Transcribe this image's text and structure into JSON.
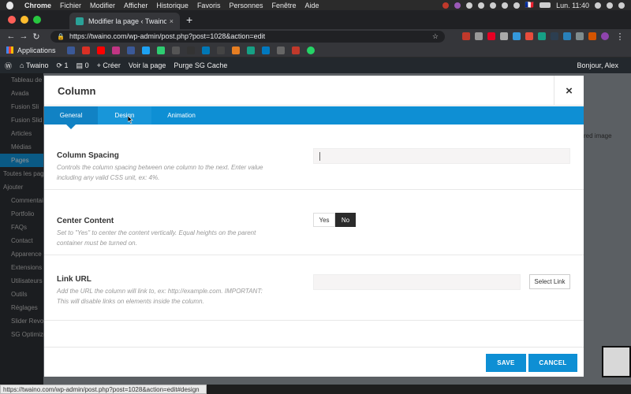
{
  "macos_menubar": {
    "app": "Chrome",
    "menus": [
      "Fichier",
      "Modifier",
      "Afficher",
      "Historique",
      "Favoris",
      "Personnes",
      "Fenêtre",
      "Aide"
    ],
    "flag": "🇫🇷",
    "clock": "Lun. 11:40"
  },
  "browser": {
    "tab_title": "Modifier la page ‹ Twaino — W",
    "url": "https://twaino.com/wp-admin/post.php?post=1028&action=edit",
    "new_tab": "+",
    "bookmarks_apps": "Applications",
    "status_url": "https://twaino.com/wp-admin/post.php?post=1028&action=edit#design"
  },
  "wp_admin_bar": {
    "site": "Twaino",
    "updates": "1",
    "comments": "0",
    "create": "Créer",
    "view_page": "Voir la page",
    "purge": "Purge SG Cache",
    "greeting": "Bonjour, Alex"
  },
  "wp_sidebar": {
    "items": [
      "Tableau de",
      "Avada",
      "Fusion Sli",
      "Fusion Slid",
      "Articles",
      "Médias",
      "Pages",
      "Toutes les pag",
      "Ajouter",
      "Commentai",
      "Portfolio",
      "FAQs",
      "Contact",
      "Apparence",
      "Extensions",
      "Utilisateurs",
      "Outils",
      "Réglages",
      "Slider Revol",
      "SG Optimizer"
    ]
  },
  "background": {
    "right_text": "red image"
  },
  "modal": {
    "title": "Column",
    "close": "×",
    "tabs": [
      "General",
      "Design",
      "Animation"
    ],
    "active_tab": "General",
    "options": {
      "column_spacing": {
        "label": "Column Spacing",
        "description": "Controls the column spacing between one column to the next. Enter value including any valid CSS unit, ex: 4%.",
        "value": ""
      },
      "center_content": {
        "label": "Center Content",
        "description": "Set to \"Yes\" to center the content vertically. Equal heights on the parent container must be turned on.",
        "yes": "Yes",
        "no": "No",
        "selected": "No"
      },
      "link_url": {
        "label": "Link URL",
        "description": "Add the URL the column will link to, ex: http://example.com. IMPORTANT: This will disable links on elements inside the column.",
        "value": "",
        "select_link": "Select Link"
      }
    },
    "save": "SAVE",
    "cancel": "CANCEL"
  },
  "colors": {
    "accent": "#0e8fd4",
    "tab_active": "#1182c4",
    "toggle_on": "#2b2b2b"
  }
}
